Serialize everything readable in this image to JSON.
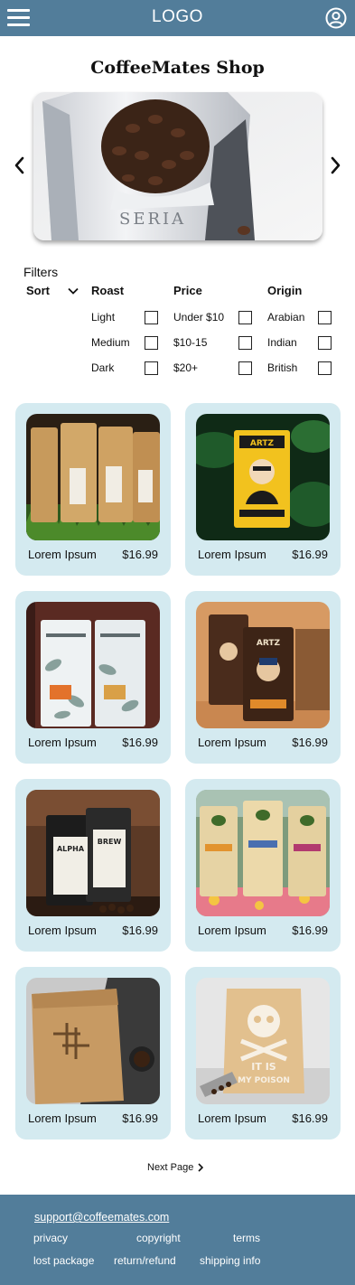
{
  "header": {
    "logo": "LOGO"
  },
  "shop_title": "CoffeeMates Shop",
  "filters": {
    "label": "Filters",
    "sort_label": "Sort",
    "columns": [
      {
        "heading": "Roast",
        "options": [
          "Light",
          "Medium",
          "Dark"
        ]
      },
      {
        "heading": "Price",
        "options": [
          "Under $10",
          "$10-15",
          "$20+"
        ]
      },
      {
        "heading": "Origin",
        "options": [
          "Arabian",
          "Indian",
          "British"
        ]
      }
    ]
  },
  "products": [
    {
      "name": "Lorem Ipsum",
      "price": "$16.99",
      "image": "kraft-bags-on-grass"
    },
    {
      "name": "Lorem Ipsum",
      "price": "$16.99",
      "image": "artz-coffee-yellow-bag"
    },
    {
      "name": "Lorem Ipsum",
      "price": "$16.99",
      "image": "sibaristica-leaf-bags"
    },
    {
      "name": "Lorem Ipsum",
      "price": "$16.99",
      "image": "artz-coffee-brown-bags"
    },
    {
      "name": "Lorem Ipsum",
      "price": "$16.99",
      "image": "alpha-brew-bags"
    },
    {
      "name": "Lorem Ipsum",
      "price": "$16.99",
      "image": "flora-alba-bags"
    },
    {
      "name": "Lorem Ipsum",
      "price": "$16.99",
      "image": "kraft-pouch-cross-logo"
    },
    {
      "name": "Lorem Ipsum",
      "price": "$16.99",
      "image": "it-is-my-poison-bag"
    }
  ],
  "pagination": {
    "next_label": "Next Page"
  },
  "footer": {
    "email": "support@coffeemates.com",
    "links": [
      "privacy",
      "copyright",
      "terms",
      "lost package",
      "return/refund",
      "shipping info"
    ]
  },
  "colors": {
    "bar": "#527d9a",
    "card": "#d4eaf0"
  }
}
